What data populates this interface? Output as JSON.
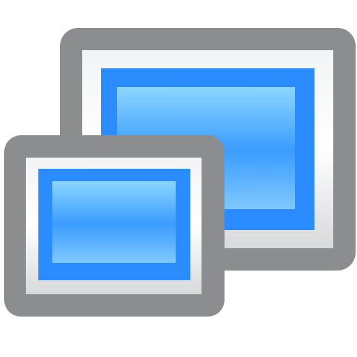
{
  "icon": {
    "name": "multi-display-icon",
    "colors": {
      "frame": "#8c8d8f",
      "bezel_light": "#ffffff",
      "bezel_dark": "#d2d4d6",
      "screen_border": "#2b8cff",
      "screen_top": "#8ad4ff",
      "screen_bottom": "#2a8dff"
    }
  }
}
